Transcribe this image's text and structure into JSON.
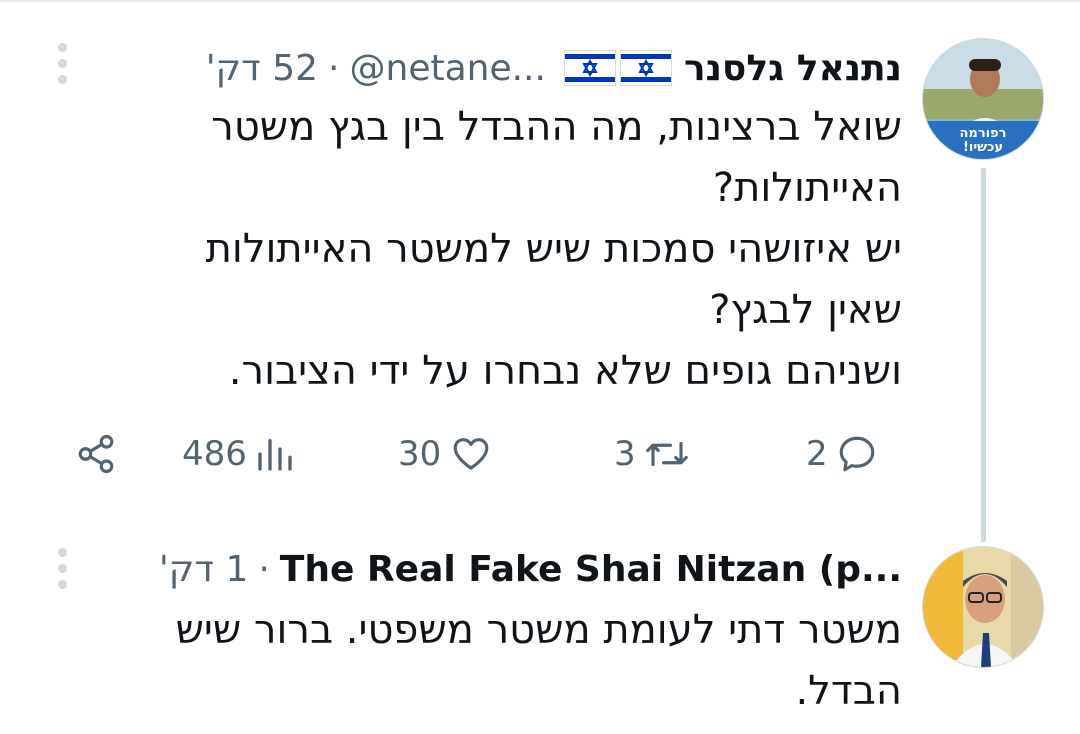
{
  "tweet1": {
    "author_name": "נתנאל גלסנר",
    "flag_icons": [
      "israel-flag-icon",
      "israel-flag-icon"
    ],
    "handle": "@netane...",
    "separator": "·",
    "time": "52 דק'",
    "avatar_badge": "רפורמה עכשיו!",
    "text_lines": [
      "שואל ברצינות, מה ההבדל בין בגץ משטר",
      "האייתולות?",
      "יש איזושהי סמכות שיש למשטר האייתולות",
      "שאין לבגץ?",
      "ושניהם גופים שלא נבחרו על ידי הציבור."
    ],
    "actions": {
      "replies": "2",
      "retweets": "3",
      "likes": "30",
      "views": "486"
    }
  },
  "tweet2": {
    "author_name": "The Real Fake Shai Nitzan (p...",
    "separator": "·",
    "time": "1 דק'",
    "text_lines": [
      "משטר דתי לעומת משטר משפטי. ברור שיש",
      "הבדל."
    ]
  },
  "colors": {
    "text_primary": "#0f1419",
    "text_secondary": "#536471",
    "thread_line": "#cfd9de",
    "flag_blue": "#0038b8"
  }
}
